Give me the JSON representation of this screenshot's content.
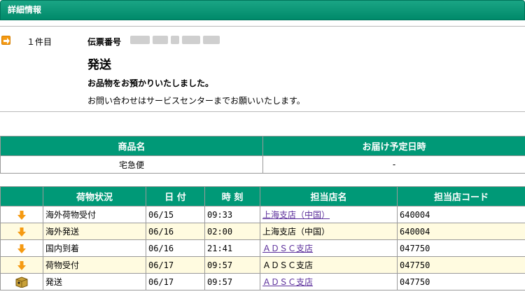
{
  "header": {
    "title": "詳細情報"
  },
  "info": {
    "count": "１件目",
    "slip_label": "伝票番号",
    "status_title": "発送",
    "status_message": "お品物をお預かりいたしました。",
    "contact_message": "お問い合わせはサービスセンターまでお願いいたします。"
  },
  "product_table": {
    "headers": [
      "商品名",
      "お届け予定日時"
    ],
    "row": [
      "宅急便",
      "-"
    ]
  },
  "tracking_table": {
    "headers": [
      "",
      "荷物状況",
      "日 付",
      "時 刻",
      "担当店名",
      "担当店コード"
    ],
    "rows": [
      {
        "icon": "down-arrow-icon",
        "status": "海外荷物受付",
        "date": "06/15",
        "time": "09:33",
        "store": "上海支店（中国）",
        "store_link": true,
        "code": "640004"
      },
      {
        "icon": "down-arrow-icon",
        "status": "海外発送",
        "date": "06/16",
        "time": "02:00",
        "store": "上海支店（中国）",
        "store_link": false,
        "code": "640004"
      },
      {
        "icon": "down-arrow-icon",
        "status": "国内到着",
        "date": "06/16",
        "time": "21:41",
        "store": "ＡＤＳＣ支店",
        "store_link": true,
        "code": "047750"
      },
      {
        "icon": "down-arrow-icon",
        "status": "荷物受付",
        "date": "06/17",
        "time": "09:57",
        "store": "ＡＤＳＣ支店",
        "store_link": false,
        "code": "047750"
      },
      {
        "icon": "box-icon",
        "status": "発送",
        "date": "06/17",
        "time": "09:57",
        "store": "ＡＤＳＣ支店",
        "store_link": true,
        "code": "047750"
      }
    ]
  },
  "colors": {
    "header_green": "#009977",
    "alt_row": "#fffbe0",
    "link": "#5a2d9a",
    "arrow_orange": "#f59a12"
  }
}
